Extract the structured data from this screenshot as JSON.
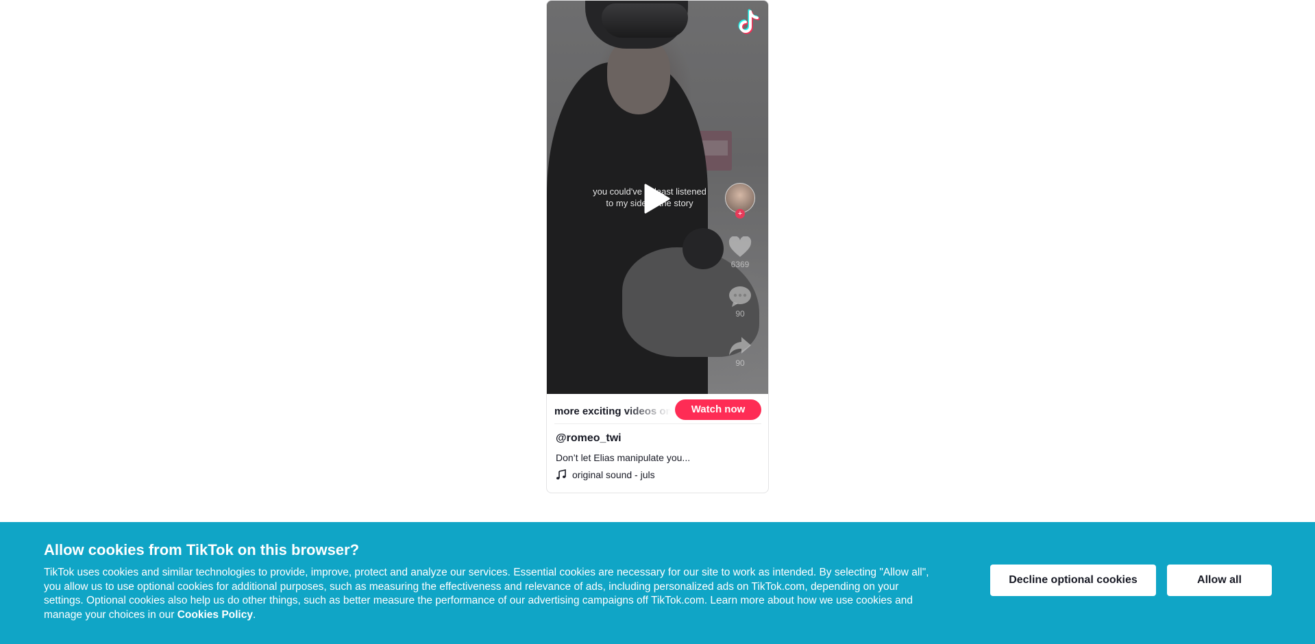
{
  "video": {
    "caption_line1": "you could've at least listened",
    "caption_line2": "to my side of the story",
    "like_count": "6369",
    "comment_count": "90",
    "share_count": "90"
  },
  "promo": {
    "text": "more exciting videos on TikTok",
    "watch_label": "Watch now"
  },
  "post": {
    "username": "@romeo_twi",
    "description": "Don’t let Elias manipulate you...",
    "sound": "original sound - juls"
  },
  "cookies": {
    "title": "Allow cookies from TikTok on this browser?",
    "body": "TikTok uses cookies and similar technologies to provide, improve, protect and analyze our services. Essential cookies are necessary for our site to work as intended. By selecting \"Allow all\", you allow us to use optional cookies for additional purposes, such as measuring the effectiveness and relevance of ads, including personalized ads on TikTok.com, depending on your settings. Optional cookies also help us do other things, such as better measure the performance of our advertising campaigns off TikTok.com. Learn more about how we use cookies and manage your choices in our ",
    "policy_link": "Cookies Policy",
    "body_end": ".",
    "decline_label": "Decline optional cookies",
    "allow_label": "Allow all",
    "banner_color": "#10a5c6"
  },
  "icons": [
    "tiktok-logo-icon",
    "play-icon",
    "heart-icon",
    "comment-icon",
    "share-icon",
    "music-note-icon",
    "plus-icon"
  ]
}
